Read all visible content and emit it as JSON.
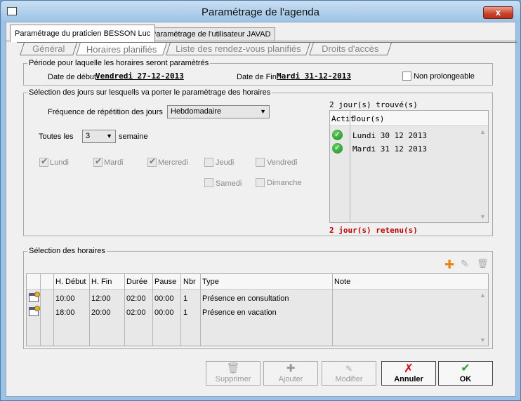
{
  "window": {
    "title": "Paramétrage de l'agenda",
    "close": "x"
  },
  "outer_tabs": [
    "Paramétrage du praticien BESSON Luc",
    "Paramétrage de l'utilisateur JAVAD"
  ],
  "inner_tabs": [
    "Général",
    "Horaires planifiés",
    "Liste des rendez-vous planifiés",
    "Droits d'accès"
  ],
  "periode": {
    "legend": "Période pour laquelle les horaires seront paramètrés",
    "debut_label": "Date de début",
    "debut_value": "Vendredi 27-12-2013",
    "fin_label": "Date de Fin",
    "fin_value": "Mardi 31-12-2013",
    "non_prolongeable": "Non prolongeable"
  },
  "selection_jours": {
    "legend": "Sélection des jours sur lesquells va porter le paramètrage des horaires",
    "frequence_label": "Fréquence de répétition des jours",
    "frequence_value": "Hebdomadaire",
    "toutes_les_label": "Toutes les",
    "toutes_les_value": "3",
    "semaine_label": "semaine",
    "days": {
      "lundi": "Lundi",
      "mardi": "Mardi",
      "mercredi": "Mercredi",
      "jeudi": "Jeudi",
      "vendredi": "Vendredi",
      "samedi": "Samedi",
      "dimanche": "Dimanche"
    },
    "checked": {
      "lundi": true,
      "mardi": true,
      "mercredi": true,
      "jeudi": false,
      "vendredi": false,
      "samedi": false,
      "dimanche": false
    },
    "found_label": "2 jour(s) trouvé(s)",
    "list_headers": {
      "actif": "Actif",
      "jours": "Jour(s)"
    },
    "found_days": [
      "Lundi 30 12 2013",
      "Mardi 31 12 2013"
    ],
    "retained_label": "2 jour(s) retenu(s)"
  },
  "horaires": {
    "legend": "Sélection des horaires",
    "headers": {
      "debut": "H. Début",
      "fin": "H. Fin",
      "duree": "Durée",
      "pause": "Pause",
      "nbr": "Nbr",
      "type": "Type",
      "note": "Note"
    },
    "rows": [
      {
        "debut": "10:00",
        "fin": "12:00",
        "duree": "02:00",
        "pause": "00:00",
        "nbr": "1",
        "type": "Présence en consultation",
        "note": ""
      },
      {
        "debut": "18:00",
        "fin": "20:00",
        "duree": "02:00",
        "pause": "00:00",
        "nbr": "1",
        "type": "Présence en vacation",
        "note": ""
      }
    ],
    "toolbar_icons": [
      "add-icon",
      "edit-icon",
      "delete-icon"
    ]
  },
  "buttons": {
    "supprimer": "Supprimer",
    "ajouter": "Ajouter",
    "modifier": "Modifier",
    "annuler": "Annuler",
    "ok": "OK"
  }
}
